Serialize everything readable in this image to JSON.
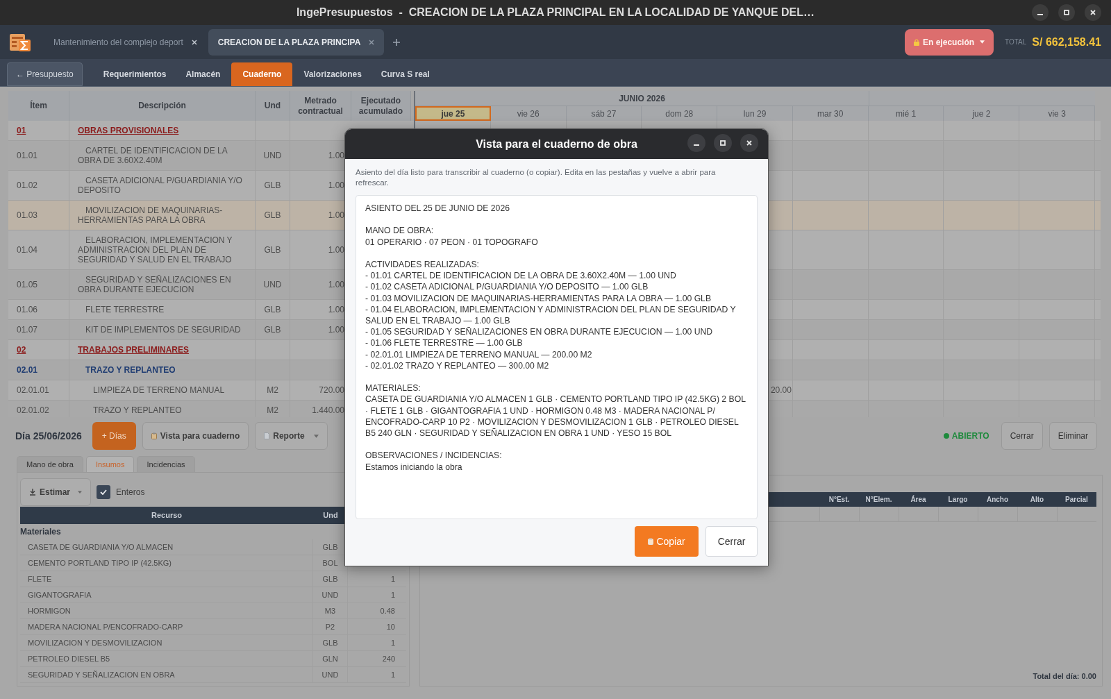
{
  "window": {
    "title": "IngePresupuestos  -  CREACION DE LA PLAZA PRINCIPAL EN LA LOCALIDAD DE YANQUE DEL…"
  },
  "doc_tabs": [
    {
      "label": "Mantenimiento del complejo deport",
      "selected": false
    },
    {
      "label": "CREACION DE LA PLAZA PRINCIPA",
      "selected": true
    }
  ],
  "status_button": {
    "label": "En ejecución"
  },
  "total": {
    "label": "TOTAL",
    "value": "S/ 662,158.41"
  },
  "back_tab": {
    "label": "← Presupuesto"
  },
  "nav_tabs": [
    {
      "label": "Requerimientos",
      "selected": false
    },
    {
      "label": "Almacén",
      "selected": false
    },
    {
      "label": "Cuaderno",
      "selected": true
    },
    {
      "label": "Valorizaciones",
      "selected": false
    },
    {
      "label": "Curva S real",
      "selected": false
    }
  ],
  "budget_table": {
    "columns": [
      "Ítem",
      "Descripción",
      "Und",
      "Metrado contractual",
      "Ejecutado acumulado"
    ],
    "rows": [
      {
        "kind": "chapter",
        "item": "01",
        "description": "OBRAS PROVISIONALES",
        "selected": false,
        "children": [
          {
            "kind": "item",
            "item": "01.01",
            "description": "CARTEL DE IDENTIFICACION DE LA OBRA DE 3.60X2.40M",
            "unit": "UND",
            "metrado": "1.00",
            "selected": false
          },
          {
            "kind": "item",
            "item": "01.02",
            "description": "CASETA ADICIONAL P/GUARDIANIA Y/O DEPOSITO",
            "unit": "GLB",
            "metrado": "1.00",
            "selected": false
          },
          {
            "kind": "item",
            "item": "01.03",
            "description": "MOVILIZACION DE MAQUINARIAS-HERRAMIENTAS PARA LA OBRA",
            "unit": "GLB",
            "metrado": "1.00",
            "selected": true
          },
          {
            "kind": "item",
            "item": "01.04",
            "description": "ELABORACION, IMPLEMENTACION Y ADMINISTRACION DEL PLAN DE SEGURIDAD Y SALUD EN EL TRABAJO",
            "unit": "GLB",
            "metrado": "1.00",
            "selected": false
          },
          {
            "kind": "item",
            "item": "01.05",
            "description": "SEGURIDAD Y SEÑALIZACIONES EN OBRA DURANTE EJECUCION",
            "unit": "UND",
            "metrado": "1.00",
            "selected": false
          },
          {
            "kind": "item",
            "item": "01.06",
            "description": "FLETE TERRESTRE",
            "unit": "GLB",
            "metrado": "1.00",
            "selected": false
          },
          {
            "kind": "item",
            "item": "01.07",
            "description": "KIT DE IMPLEMENTOS DE SEGURIDAD",
            "unit": "GLB",
            "metrado": "1.00",
            "selected": false
          }
        ]
      },
      {
        "kind": "chapter",
        "item": "02",
        "description": "TRABAJOS PRELIMINARES",
        "selected": false,
        "children": [
          {
            "kind": "subchapter",
            "item": "02.01",
            "description": "TRAZO Y REPLANTEO",
            "selected": false,
            "children": [
              {
                "kind": "item",
                "item": "02.01.01",
                "description": "LIMPIEZA DE TERRENO MANUAL",
                "unit": "M2",
                "metrado": "720.00",
                "calendar_value": "20.00",
                "selected": false
              },
              {
                "kind": "item",
                "item": "02.01.02",
                "description": "TRAZO Y REPLANTEO",
                "unit": "M2",
                "metrado": "1.440.00",
                "selected": false
              }
            ]
          }
        ]
      }
    ]
  },
  "calendar": {
    "month": "JUNIO 2026",
    "days": [
      {
        "label": "jue 25",
        "selected": true
      },
      {
        "label": "vie 26",
        "selected": false
      },
      {
        "label": "sáb 27",
        "selected": false
      },
      {
        "label": "dom 28",
        "selected": false
      },
      {
        "label": "lun 29",
        "selected": false
      },
      {
        "label": "mar 30",
        "selected": false
      },
      {
        "label": "mié 1",
        "selected": false
      },
      {
        "label": "jue 2",
        "selected": false
      },
      {
        "label": "vie 3",
        "selected": false
      }
    ]
  },
  "day_panel": {
    "date": "Día 25/06/2026",
    "buttons": [
      {
        "kind": "primary",
        "label": "+ Días"
      },
      {
        "kind": "clipboard",
        "label": "Vista para cuaderno"
      },
      {
        "kind": "dropdown",
        "label": "Reporte"
      }
    ],
    "status": {
      "label": "ABIERTO"
    },
    "actions": [
      "Cerrar",
      "Eliminar"
    ],
    "tabs": [
      {
        "label": "Mano de obra",
        "selected": false
      },
      {
        "label": "Insumos",
        "selected": true
      },
      {
        "label": "Incidencias",
        "selected": false
      }
    ],
    "estimate_button": {
      "label": "Estimar"
    },
    "integers_checkbox": {
      "label": "Enteros",
      "checked": true
    },
    "resources": {
      "columns": [
        "Recurso",
        "Und"
      ],
      "group": "Materiales",
      "rows": [
        {
          "name": "CASETA DE GUARDIANIA Y/O ALMACEN",
          "unit": "GLB"
        },
        {
          "name": "CEMENTO PORTLAND TIPO IP (42.5KG)",
          "unit": "BOL"
        },
        {
          "name": "FLETE",
          "unit": "GLB",
          "quantity": "1"
        },
        {
          "name": "GIGANTOGRAFIA",
          "unit": "UND",
          "quantity": "1"
        },
        {
          "name": "HORMIGON",
          "unit": "M3",
          "quantity": "0.48"
        },
        {
          "name": "MADERA NACIONAL P/ENCOFRADO-CARP",
          "unit": "P2",
          "quantity": "10"
        },
        {
          "name": "MOVILIZACION Y DESMOVILIZACION",
          "unit": "GLB",
          "quantity": "1"
        },
        {
          "name": "PETROLEO DIESEL B5",
          "unit": "GLN",
          "quantity": "240"
        },
        {
          "name": "SEGURIDAD Y SEÑALIZACION EN OBRA",
          "unit": "UND",
          "quantity": "1"
        }
      ]
    },
    "measurements": {
      "columns": [
        "N°Est.",
        "N°Elem.",
        "Área",
        "Largo",
        "Ancho",
        "Alto",
        "Parcial"
      ],
      "total": "Total del día: 0.00"
    }
  },
  "dialog": {
    "title": "Vista para el cuaderno de obra",
    "hint": "Asiento del día listo para transcribir al cuaderno (o copiar). Edita en las pestañas y vuelve a abrir para refrescar.",
    "note": {
      "heading": "ASIENTO DEL 25 DE JUNIO DE 2026",
      "sections": [
        {
          "heading": "MANO DE OBRA:",
          "lines": [
            "01 OPERARIO · 07 PEON · 01 TOPOGRAFO"
          ]
        },
        {
          "heading": "ACTIVIDADES REALIZADAS:",
          "lines": [
            "- 01.01 CARTEL DE IDENTIFICACION DE LA OBRA DE 3.60X2.40M — 1.00 UND",
            "- 01.02 CASETA ADICIONAL P/GUARDIANIA Y/O DEPOSITO — 1.00 GLB",
            "- 01.03 MOVILIZACION DE MAQUINARIAS-HERRAMIENTAS PARA LA OBRA — 1.00 GLB",
            "- 01.04 ELABORACION, IMPLEMENTACION Y ADMINISTRACION DEL PLAN DE SEGURIDAD Y SALUD EN EL TRABAJO — 1.00 GLB",
            "- 01.05 SEGURIDAD Y SEÑALIZACIONES EN OBRA DURANTE EJECUCION — 1.00 UND",
            "- 01.06 FLETE TERRESTRE — 1.00 GLB",
            "- 02.01.01 LIMPIEZA DE TERRENO MANUAL — 200.00 M2",
            "- 02.01.02 TRAZO Y REPLANTEO — 300.00 M2"
          ]
        },
        {
          "heading": "MATERIALES:",
          "lines": [
            "CASETA DE GUARDIANIA Y/O ALMACEN 1 GLB · CEMENTO PORTLAND TIPO IP (42.5KG) 2 BOL · FLETE 1 GLB · GIGANTOGRAFIA 1 UND · HORMIGON 0.48 M3 · MADERA NACIONAL P/ ENCOFRADO-CARP 10 P2 · MOVILIZACION Y DESMOVILIZACION 1 GLB · PETROLEO DIESEL B5 240 GLN · SEGURIDAD Y SEÑALIZACION EN OBRA 1 UND · YESO 15 BOL"
          ]
        },
        {
          "heading": "OBSERVACIONES / INCIDENCIAS:",
          "lines": [
            "Estamos iniciando la obra"
          ]
        }
      ]
    },
    "buttons": [
      {
        "kind": "primary",
        "label": "Copiar"
      },
      {
        "kind": "secondary",
        "label": "Cerrar"
      }
    ]
  }
}
